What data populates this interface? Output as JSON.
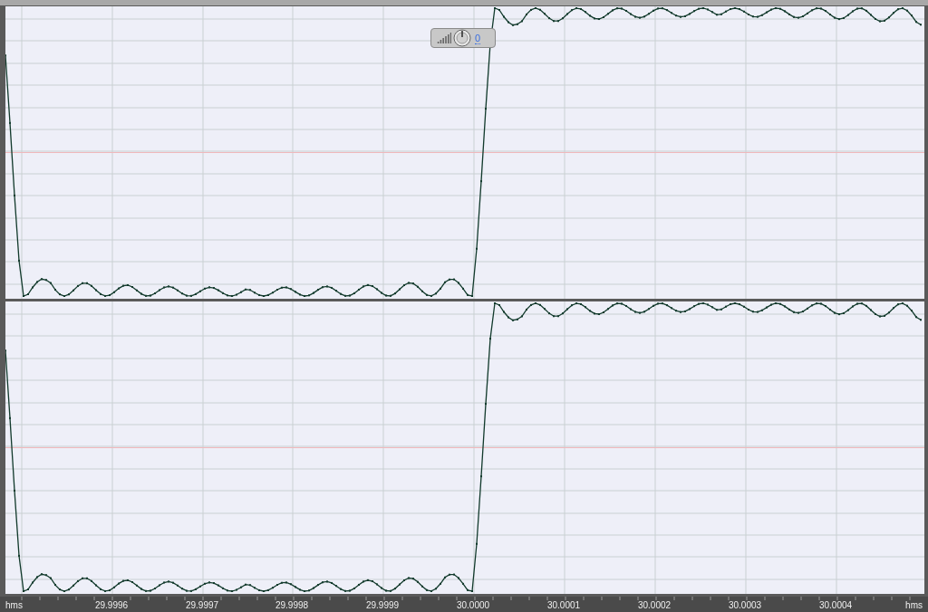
{
  "volume_overlay": {
    "value": "0"
  },
  "time_ruler": {
    "unit_left": "hms",
    "unit_right": "hms",
    "labels": [
      "29.9996",
      "29.9997",
      "29.9998",
      "29.9999",
      "30.0000",
      "30.0001",
      "30.0002",
      "30.0003",
      "30.0004"
    ]
  }
}
